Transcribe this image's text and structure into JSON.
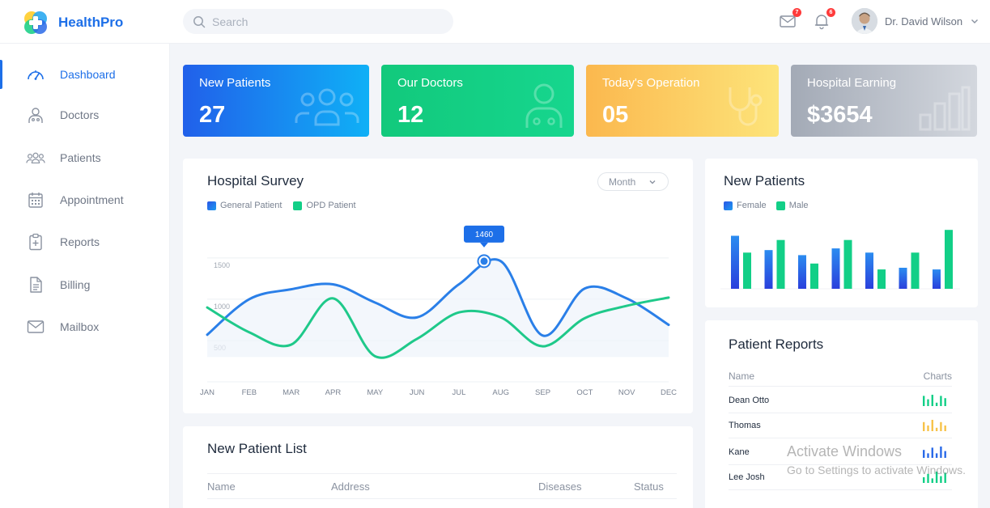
{
  "app": {
    "name": "HealthPro"
  },
  "search": {
    "placeholder": "Search"
  },
  "header": {
    "mail_badge": "7",
    "notif_badge": "6",
    "user_name": "Dr. David Wilson"
  },
  "sidebar": {
    "items": [
      {
        "label": "Dashboard",
        "icon": "speedometer-icon",
        "active": true
      },
      {
        "label": "Doctors",
        "icon": "doctor-icon"
      },
      {
        "label": "Patients",
        "icon": "group-icon"
      },
      {
        "label": "Appointment",
        "icon": "calendar-icon"
      },
      {
        "label": "Reports",
        "icon": "clipboard-icon"
      },
      {
        "label": "Billing",
        "icon": "document-icon"
      },
      {
        "label": "Mailbox",
        "icon": "mail-icon"
      }
    ]
  },
  "stats": [
    {
      "title": "New Patients",
      "value": "27",
      "icon": "people-icon",
      "color": "#1f6ee9"
    },
    {
      "title": "Our Doctors",
      "value": "12",
      "icon": "doctor-icon",
      "color": "#0fcf83"
    },
    {
      "title": "Today's Operation",
      "value": "05",
      "icon": "stethoscope-icon",
      "color": "#fbc85a"
    },
    {
      "title": "Hospital Earning",
      "value": "$3654",
      "icon": "bar-chart-icon",
      "color": "#aab1bc"
    }
  ],
  "survey": {
    "title": "Hospital Survey",
    "period": "Month",
    "legend": [
      "General Patient",
      "OPD Patient"
    ],
    "tooltip": "1460"
  },
  "chart_data": [
    {
      "type": "line",
      "title": "Hospital Survey",
      "categories": [
        "JAN",
        "FEB",
        "MAR",
        "APR",
        "MAY",
        "JUN",
        "JUL",
        "AUG",
        "SEP",
        "OCT",
        "NOV",
        "DEC"
      ],
      "yticks": [
        "1500",
        "1000",
        "500"
      ],
      "ylim": [
        0,
        1900
      ],
      "grid": true,
      "series": [
        {
          "name": "General Patient",
          "color": "#2a7fe8",
          "values": [
            570,
            1000,
            1120,
            1180,
            960,
            780,
            1180,
            1460,
            560,
            1130,
            1010,
            690
          ]
        },
        {
          "name": "OPD Patient",
          "color": "#1fc98a",
          "values": [
            900,
            600,
            450,
            1010,
            310,
            520,
            840,
            780,
            430,
            770,
            920,
            1020
          ]
        }
      ],
      "annotation": {
        "x": "JUL",
        "label": "1460"
      }
    },
    {
      "type": "bar",
      "title": "New Patients",
      "categories": [
        "1",
        "2",
        "3",
        "4",
        "5",
        "6",
        "7"
      ],
      "ylim": [
        0,
        75
      ],
      "series": [
        {
          "name": "Female",
          "color": "#2a6ae8",
          "values": [
            63,
            46,
            40,
            48,
            43,
            25,
            23
          ]
        },
        {
          "name": "Male",
          "color": "#12cf87",
          "values": [
            43,
            58,
            30,
            58,
            23,
            43,
            70
          ]
        }
      ]
    }
  ],
  "new_patients": {
    "title": "New Patients",
    "legend": [
      "Female",
      "Male"
    ]
  },
  "patient_reports": {
    "title": "Patient Reports",
    "col_name": "Name",
    "col_charts": "Charts",
    "rows": [
      {
        "name": "Dean Otto",
        "color": "#12cf87",
        "bars": [
          0.9,
          0.6,
          1.0,
          0.3,
          0.9,
          0.7
        ]
      },
      {
        "name": "Thomas",
        "color": "#f7c34a",
        "bars": [
          0.8,
          0.5,
          1.0,
          0.3,
          0.8,
          0.5
        ]
      },
      {
        "name": "Kane",
        "color": "#2a6ae8",
        "bars": [
          0.7,
          0.4,
          0.9,
          0.4,
          1.0,
          0.6
        ]
      },
      {
        "name": "Lee Josh",
        "color": "#12cf87",
        "bars": [
          0.5,
          0.8,
          0.4,
          1.0,
          0.6,
          0.9
        ]
      }
    ]
  },
  "patient_list": {
    "title": "New Patient List",
    "columns": [
      "Name",
      "Address",
      "Diseases",
      "Status"
    ]
  },
  "watermark": {
    "line1": "Activate Windows",
    "line2": "Go to Settings to activate Windows."
  }
}
